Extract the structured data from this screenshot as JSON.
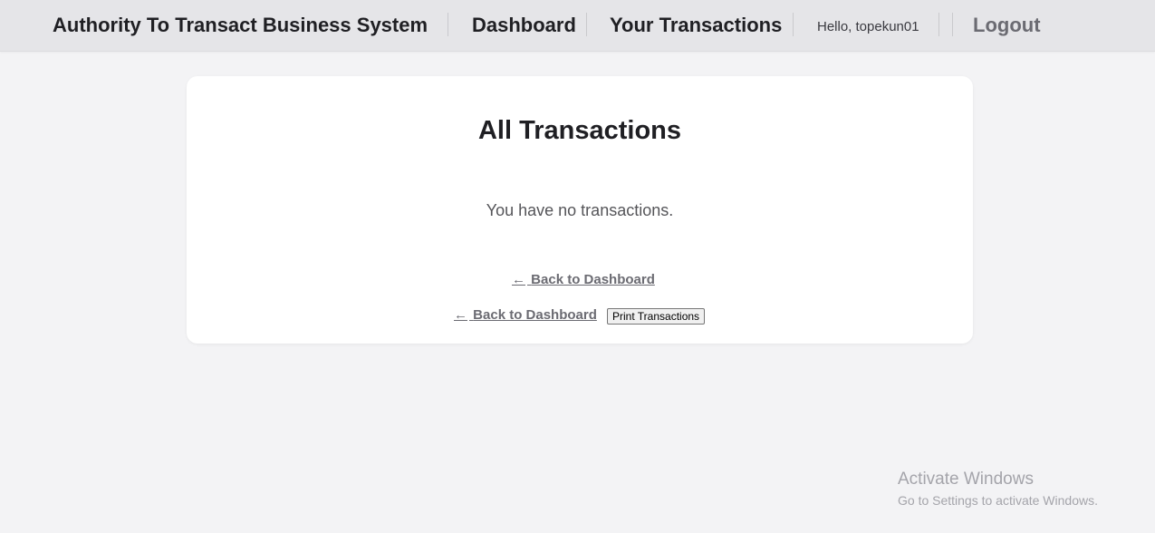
{
  "nav": {
    "brand": "Authority To Transact Business System",
    "dashboard": "Dashboard",
    "transactions": "Your Transactions",
    "greeting": "Hello, topekun01",
    "logout": "Logout"
  },
  "main": {
    "title": "All Transactions",
    "empty_message": "You have no transactions.",
    "back_link_arrow": "←",
    "back_link_label": "Back to Dashboard",
    "print_button": "Print Transactions"
  },
  "watermark": {
    "title": "Activate Windows",
    "subtitle": "Go to Settings to activate Windows."
  },
  "colors": {
    "background": "#f3f3f5",
    "navbar": "#e5e5e8",
    "card": "#ffffff",
    "link": "#6b6b72"
  }
}
